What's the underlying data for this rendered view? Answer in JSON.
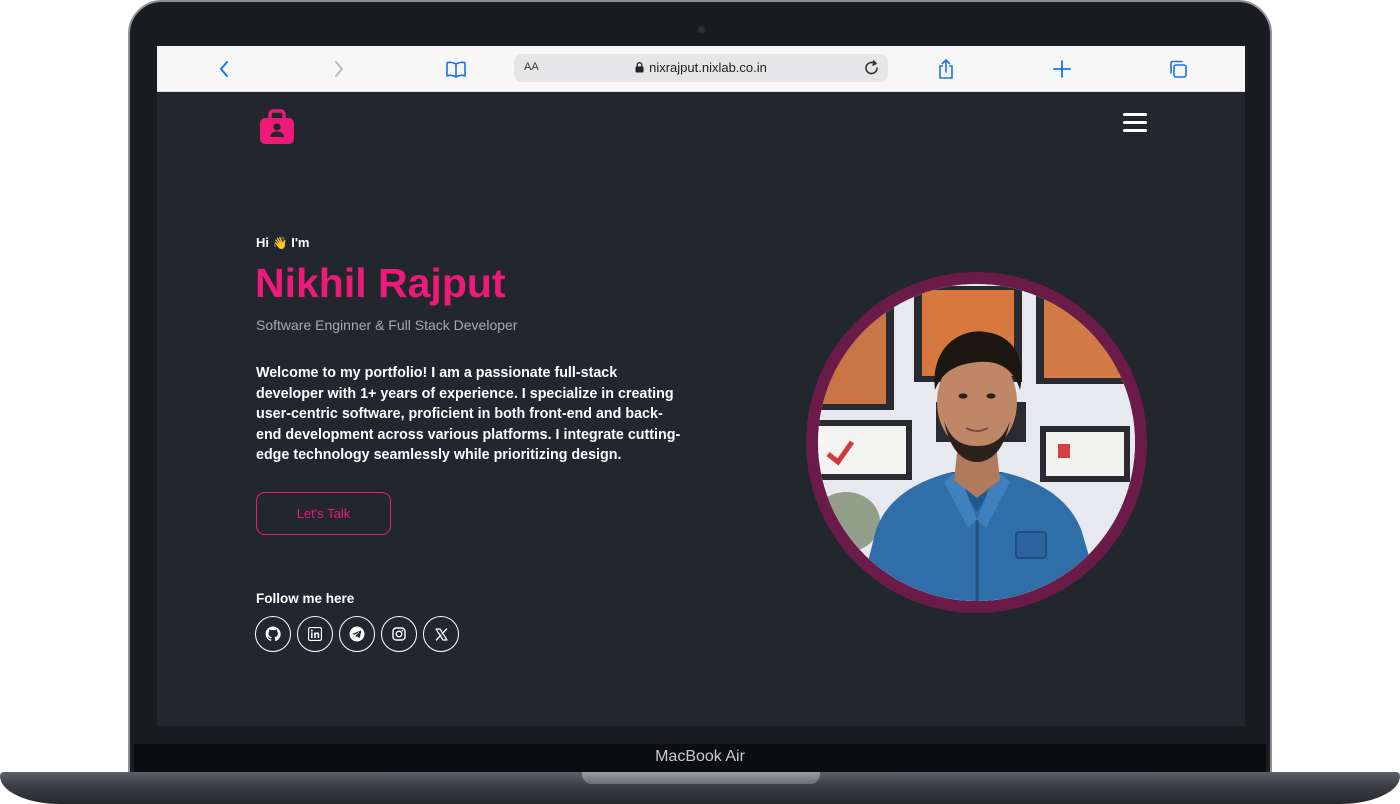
{
  "device": {
    "label": "MacBook Air"
  },
  "browser": {
    "text_size_label": "AA",
    "url": "nixrajput.nixlab.co.in"
  },
  "hero": {
    "greeting_prefix": "Hi",
    "greeting_emoji": "👋",
    "greeting_suffix": "I'm",
    "name": "Nikhil Rajput",
    "role": "Software Enginner & Full Stack Developer",
    "bio": "Welcome to my portfolio! I am a passionate full-stack developer with 1+ years of experience. I specialize in creating user-centric software, proficient in both front-end and back-end development across various platforms. I integrate cutting-edge technology seamlessly while prioritizing design.",
    "cta_label": "Let's Talk"
  },
  "social": {
    "heading": "Follow me here",
    "links": [
      {
        "icon": "github-icon"
      },
      {
        "icon": "linkedin-icon"
      },
      {
        "icon": "telegram-icon"
      },
      {
        "icon": "instagram-icon"
      },
      {
        "icon": "x-icon"
      }
    ]
  },
  "colors": {
    "accent": "#ee1a77",
    "page_background": "#22262d",
    "portrait_ring": "#6b1b48"
  }
}
